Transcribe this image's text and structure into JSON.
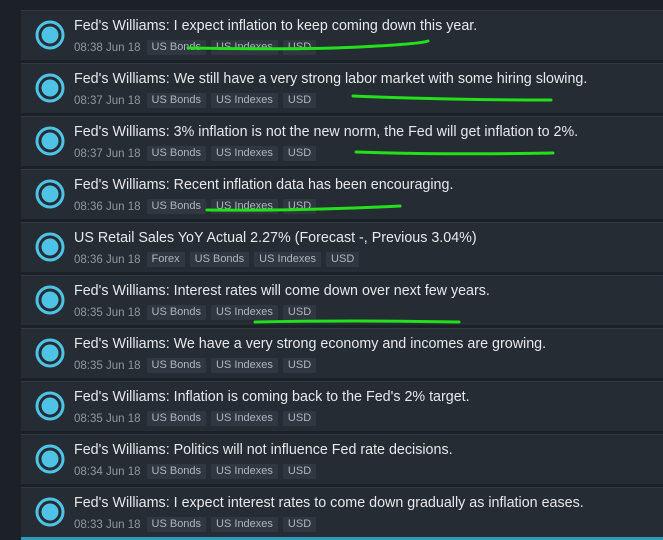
{
  "feed": {
    "items": [
      {
        "headline": "Fed's Williams: I expect inflation to keep coming down this year.",
        "time": "08:38 Jun 18",
        "tags": [
          "US Bonds",
          "US Indexes",
          "USD"
        ]
      },
      {
        "headline": "Fed's Williams: We still have a very strong labor market with some hiring slowing.",
        "time": "08:37 Jun 18",
        "tags": [
          "US Bonds",
          "US Indexes",
          "USD"
        ]
      },
      {
        "headline": "Fed's Williams: 3% inflation is not the new norm, the Fed will get inflation to 2%.",
        "time": "08:37 Jun 18",
        "tags": [
          "US Bonds",
          "US Indexes",
          "USD"
        ]
      },
      {
        "headline": "Fed's Williams: Recent inflation data has been encouraging.",
        "time": "08:36 Jun 18",
        "tags": [
          "US Bonds",
          "US Indexes",
          "USD"
        ]
      },
      {
        "headline": "US Retail Sales YoY Actual 2.27% (Forecast -, Previous 3.04%)",
        "time": "08:36 Jun 18",
        "tags": [
          "Forex",
          "US Bonds",
          "US Indexes",
          "USD"
        ]
      },
      {
        "headline": "Fed's Williams: Interest rates will come down over next few years.",
        "time": "08:35 Jun 18",
        "tags": [
          "US Bonds",
          "US Indexes",
          "USD"
        ]
      },
      {
        "headline": "Fed's Williams: We have a very strong economy and incomes are growing.",
        "time": "08:35 Jun 18",
        "tags": [
          "US Bonds",
          "US Indexes",
          "USD"
        ]
      },
      {
        "headline": "Fed's Williams: Inflation is coming back to the Fed's 2% target.",
        "time": "08:35 Jun 18",
        "tags": [
          "US Bonds",
          "US Indexes",
          "USD"
        ]
      },
      {
        "headline": "Fed's Williams: Politics will not influence Fed rate decisions.",
        "time": "08:34 Jun 18",
        "tags": [
          "US Bonds",
          "US Indexes",
          "USD"
        ]
      },
      {
        "headline": "Fed's Williams: I expect interest rates to come down gradually as inflation eases.",
        "time": "08:33 Jun 18",
        "tags": [
          "US Bonds",
          "US Indexes",
          "USD"
        ]
      }
    ]
  },
  "colors": {
    "background": "#1c2127",
    "item_background": "#262c33",
    "accent": "#4fc3e6",
    "highlight_marker": "#22e01a"
  },
  "icons": {
    "item_icon": "news-circle-icon"
  }
}
